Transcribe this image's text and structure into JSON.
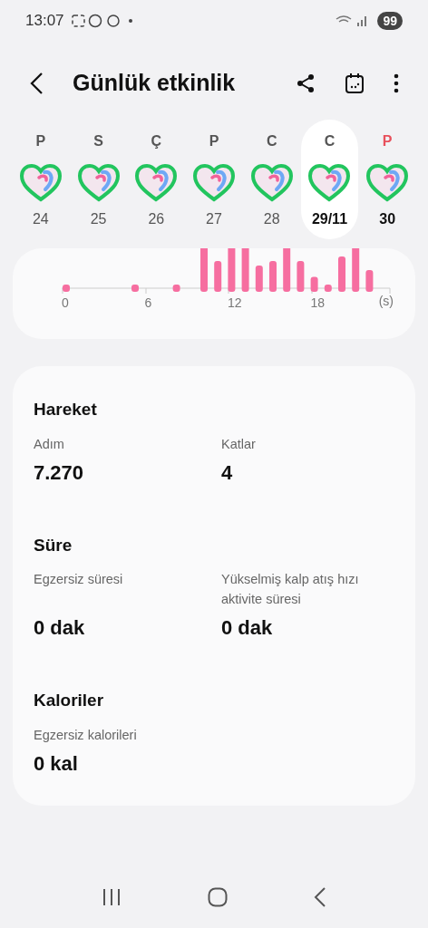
{
  "status_bar": {
    "time": "13:07",
    "battery": "99"
  },
  "header": {
    "title": "Günlük etkinlik"
  },
  "days": [
    {
      "letter": "P",
      "color": "#555555",
      "date": "24",
      "selected": false,
      "bold": false
    },
    {
      "letter": "S",
      "color": "#555555",
      "date": "25",
      "selected": false,
      "bold": false
    },
    {
      "letter": "Ç",
      "color": "#555555",
      "date": "26",
      "selected": false,
      "bold": false
    },
    {
      "letter": "P",
      "color": "#555555",
      "date": "27",
      "selected": false,
      "bold": false
    },
    {
      "letter": "C",
      "color": "#555555",
      "date": "28",
      "selected": false,
      "bold": false
    },
    {
      "letter": "C",
      "color": "#555555",
      "date": "29/11",
      "selected": true,
      "bold": true
    },
    {
      "letter": "P",
      "color": "#e8505b",
      "date": "30",
      "selected": false,
      "bold": true
    }
  ],
  "hourly_chart": {
    "x_labels": [
      "0",
      "6",
      "12",
      "18"
    ],
    "unit": "(s)"
  },
  "sections": [
    {
      "title": "Hareket",
      "stats": [
        {
          "label": "Adım",
          "value": "7.270"
        },
        {
          "label": "Katlar",
          "value": "4"
        }
      ]
    },
    {
      "title": "Süre",
      "stats": [
        {
          "label": "Egzersiz süresi",
          "value": "0 dak"
        },
        {
          "label": "Yükselmiş kalp atış hızı aktivite süresi",
          "value": "0 dak"
        }
      ]
    },
    {
      "title": "Kaloriler",
      "stats": [
        {
          "label": "Egzersiz kalorileri",
          "value": "0 kal"
        }
      ]
    }
  ]
}
